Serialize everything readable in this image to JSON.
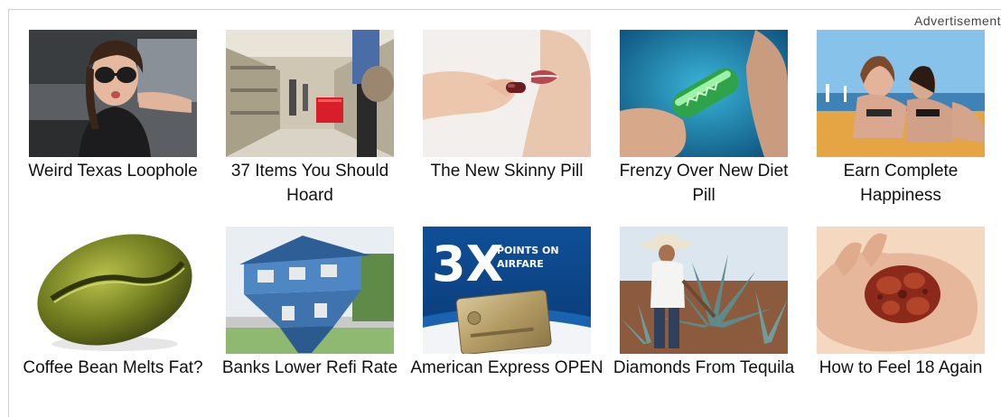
{
  "ad_label": "Advertisement",
  "ads": [
    {
      "caption": "Weird Texas Loophole",
      "image": "woman-sunglasses-blowing-kiss-car"
    },
    {
      "caption": "37 Items You Should Hoard",
      "image": "empty-supermarket-aisle-red-basket"
    },
    {
      "caption": "The New Skinny Pill",
      "image": "hand-placing-pill-in-mouth"
    },
    {
      "caption": "Frenzy Over New Diet Pill",
      "image": "fingers-holding-green-capsule"
    },
    {
      "caption": "Earn Complete Happiness",
      "image": "women-in-bikinis-on-boat"
    },
    {
      "caption": "Coffee Bean Melts Fat?",
      "image": "green-coffee-bean"
    },
    {
      "caption": "Banks Lower Refi Rate",
      "image": "upside-down-blue-house"
    },
    {
      "caption": "American Express OPEN",
      "image": "3x-points-airfare-gold-card",
      "image_text": "3X",
      "image_subtext": [
        "POINTS ON",
        "AIRFARE"
      ]
    },
    {
      "caption": "Diamonds From Tequila",
      "image": "farmer-harvesting-agave"
    },
    {
      "caption": "How to Feel 18 Again",
      "image": "hand-holding-red-herb"
    }
  ]
}
